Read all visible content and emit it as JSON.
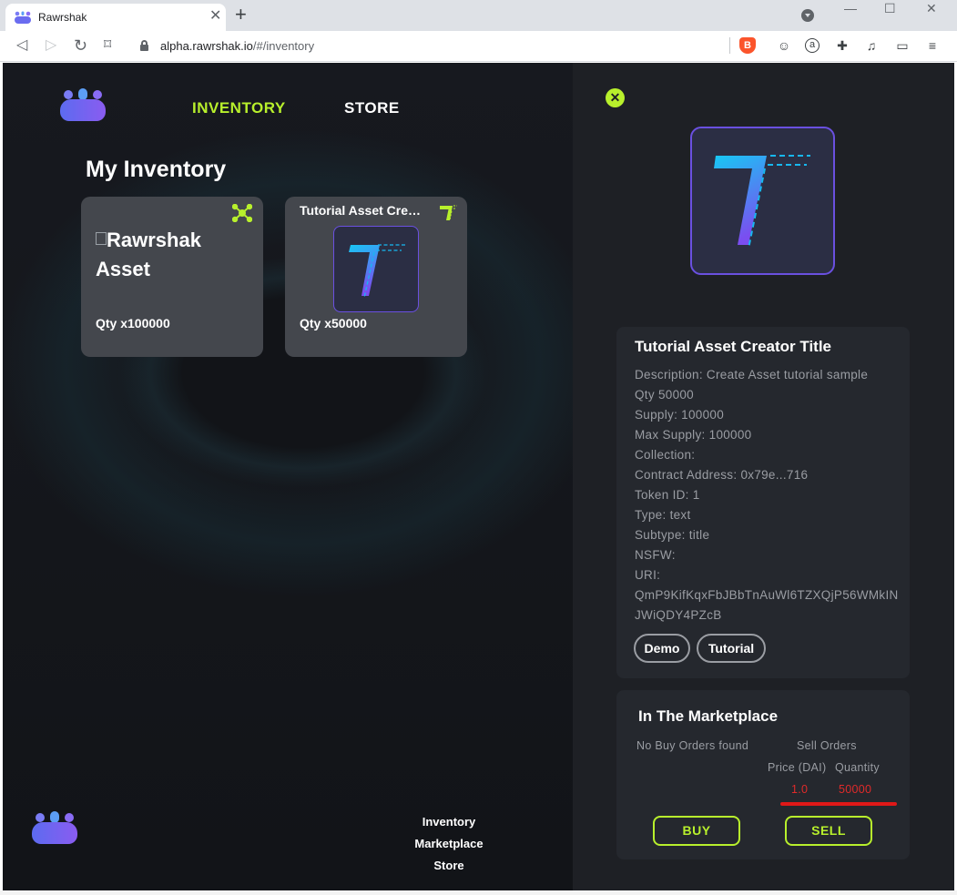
{
  "browser": {
    "tab_title": "Rawrshak",
    "tab_close": "✕",
    "new_tab": "+",
    "url_host": "alpha.rawrshak.io",
    "url_path": "/#/inventory",
    "window_controls": {
      "minimize": "—",
      "maximize": "☐",
      "close": "✕"
    },
    "nav": {
      "back": "◁",
      "forward": "▷",
      "reload": "↻",
      "bookmark": "⌑"
    },
    "extensions": [
      "brave-shield-icon",
      "avatar-icon",
      "a-circle-icon",
      "puzzle-icon",
      "media-icon",
      "wallet-icon",
      "menu-icon"
    ]
  },
  "app": {
    "nav": {
      "inventory": "INVENTORY",
      "store": "STORE"
    },
    "page_title": "My Inventory",
    "cards": [
      {
        "image_alt": "Rawrshak Asset",
        "qty": "Qty x100000",
        "badge_icon": "network-icon"
      },
      {
        "title": "Tutorial Asset Creator Title",
        "qty": "Qty x50000",
        "badge_icon": "t-logo-icon"
      }
    ],
    "footer": {
      "links": [
        "Inventory",
        "Marketplace",
        "Store"
      ]
    },
    "colors": {
      "accent": "#b8f02c",
      "panel": "#1e2025",
      "card": "#44474d",
      "sell_value": "#e02a2a",
      "thumb_border": "#6a50e0"
    }
  },
  "detail": {
    "close_icon": "✕",
    "title": "Tutorial Asset Creator Title",
    "lines": [
      "Description: Create Asset tutorial sample",
      "Qty 50000",
      "Supply: 100000",
      "Max Supply: 100000",
      "Collection:",
      "Contract Address: 0x79e...716",
      "Token ID: 1",
      "Type: text",
      "Subtype: title",
      "NSFW:",
      "URI: QmP9KifKqxFbJBbTnAuWl6TZXQjP56WMkINJWiQDY4PZcB"
    ],
    "tags": [
      "Demo",
      "Tutorial"
    ]
  },
  "market": {
    "title": "In The Marketplace",
    "no_buy": "No Buy Orders found",
    "sell_orders": "Sell Orders",
    "price_header": "Price (DAI)",
    "qty_header": "Quantity",
    "sell_price": "1.0",
    "sell_qty": "50000",
    "buy_label": "BUY",
    "sell_label": "SELL"
  }
}
